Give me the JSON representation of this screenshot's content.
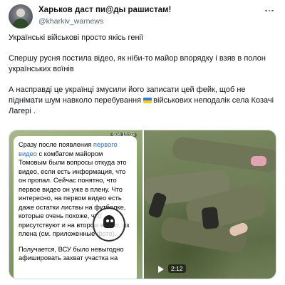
{
  "author": {
    "name": "Харьков даст пи@ды рашистам!",
    "handle": "@kharkiv_warnews",
    "avatar_icon": "avatar-soldier-icon"
  },
  "more_icon": "more-horizontal-icon",
  "tweet": {
    "paragraphs": [
      "Українські військові просто якісь генії",
      "Спершу русня постила відео, як ніби-то майор впорядку і взяв в полон українських воїнів",
      "А насправді це українці змусили його записати цей фейк, щоб не піднімати шум навколо перебування",
      "військових неподалік села Козачі Лагері ."
    ],
    "flag_icon": "ukraine-flag-icon"
  },
  "media": {
    "left": {
      "view_count": "604 15:03",
      "message_lines": {
        "intro": "Сразу после появления ",
        "link": "первого видео",
        "rest": " с комбатом майором Томовым были вопросы откуда это видео, если есть информация, что он пропал. Сейчас понятно, что первое видео он уже в плену. Что интересно, на первом видео есть даже остатки листвы на футболке, которые очень похоже, что присутствуют и на втором видео, из плена (см. приложенные фото).",
        "second": "Получается, ВСУ было невыгодно афишировать захват участка на"
      },
      "watermark_icon": "skull-watermark-icon"
    },
    "right": {
      "duration": "2:12",
      "play_icon": "play-icon"
    }
  },
  "colors": {
    "link": "#2a6ebb",
    "muted": "#536471",
    "text": "#0f1419"
  }
}
